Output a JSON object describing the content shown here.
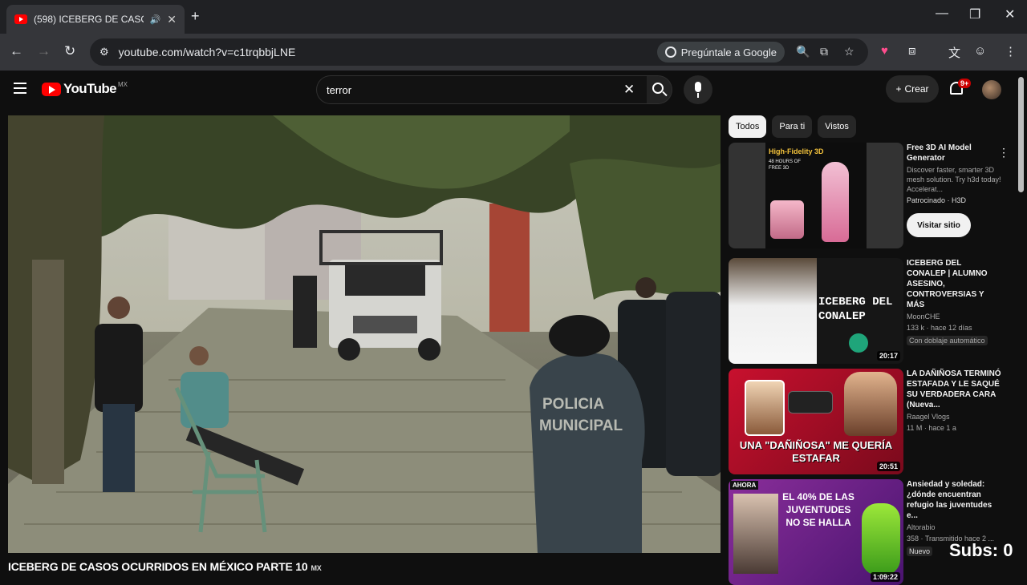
{
  "browser": {
    "tab_title": "(598) ICEBERG DE CASOS O",
    "address": "youtube.com/watch?v=c1trqbbjLNE",
    "ask_google": "Pregúntale a Google"
  },
  "youtube": {
    "logo_text": "YouTube",
    "country_code": "MX",
    "search_value": "terror",
    "create_label": "Crear",
    "notifications": "9+"
  },
  "video": {
    "title": "ICEBERG DE CASOS OCURRIDOS EN MÉXICO PARTE 10",
    "flag": "MX",
    "watermark": "POLICIA MUNICIPAL"
  },
  "chips": [
    "Todos",
    "Para ti",
    "Vistos"
  ],
  "ad": {
    "title": "Free 3D AI Model Generator",
    "description": "Discover faster, smarter 3D mesh solution. Try h3d today! Accelerat...",
    "sponsored": "Patrocinado · H3D",
    "visit": "Visitar sitio",
    "thumb_headline": "High-Fidelity 3D",
    "thumb_sub": "48 HOURS OF FREE 3D"
  },
  "recommendations": [
    {
      "title": "ICEBERG DEL CONALEP | ALUMNO ASESINO, CONTROVERSIAS Y MÁS",
      "channel": "MoonCHE",
      "stats": "133 k · hace 12 días",
      "extra": "Con doblaje automático",
      "duration": "20:17",
      "thumb_text": "ICEBERG DEL CONALEP"
    },
    {
      "title": "LA DAÑIÑOSA TERMINÓ ESTAFADA Y LE SAQUÉ SU VERDADERA CARA (Nueva...",
      "channel": "Raagel Vlogs",
      "stats": "11 M · hace 1 a",
      "duration": "20:51",
      "thumb_text": "UNA \"DAÑIÑOSA\" ME QUERÍA ESTAFAR"
    },
    {
      "title": "Ansiedad y soledad: ¿dónde encuentran refugio las juventudes e...",
      "channel": "Altorabio",
      "stats": "358 · Transmitido hace 2 ...",
      "extra": "Nuevo",
      "duration": "1:09:22",
      "thumb_text": "EL 40% DE LAS JUVENTUDES NO SE HALLA",
      "thumb_tag": "AHORA"
    }
  ],
  "overlay": {
    "subs": "Subs: 0"
  }
}
